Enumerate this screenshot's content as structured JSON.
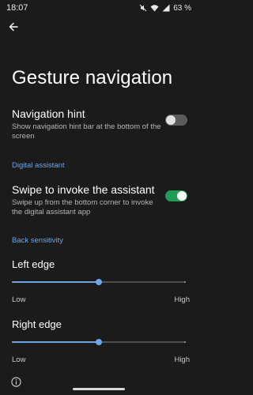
{
  "status_bar": {
    "time": "18:07",
    "battery_text": "63 %",
    "icons": [
      "mute-icon",
      "wifi-icon",
      "signal-icon",
      "battery-icon"
    ]
  },
  "page": {
    "title": "Gesture navigation",
    "back_icon": "arrow-back-icon"
  },
  "navigation_hint": {
    "title": "Navigation hint",
    "summary": "Show navigation hint bar at the bottom of the screen",
    "enabled": false
  },
  "digital_assistant": {
    "header": "Digital assistant",
    "title": "Swipe to invoke the assistant",
    "summary": "Swipe up from the bottom corner to invoke the digital assistant app",
    "enabled": true
  },
  "back_sensitivity": {
    "header": "Back sensitivity",
    "left_edge": {
      "label": "Left edge",
      "value": 0.5,
      "min_label": "Low",
      "max_label": "High"
    },
    "right_edge": {
      "label": "Right edge",
      "value": 0.5,
      "min_label": "Low",
      "max_label": "High"
    }
  },
  "colors": {
    "background": "#1b1b1b",
    "accent": "#6ea6e6",
    "toggle_on": "#1f9d55",
    "toggle_off": "#5b5b5b"
  },
  "footer": {
    "info_icon": "info-icon"
  }
}
